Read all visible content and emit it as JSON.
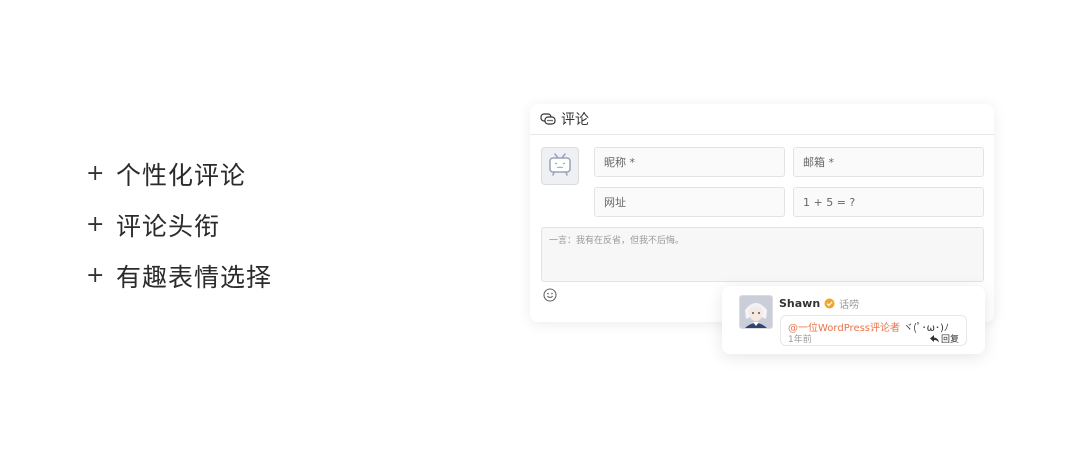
{
  "features": [
    {
      "plus": "+",
      "label": "个性化评论"
    },
    {
      "plus": "+",
      "label": "评论头衔"
    },
    {
      "plus": "+",
      "label": "有趣表情选择"
    }
  ],
  "comment_box": {
    "title": "评论",
    "title_icon": "comment-bubble-icon",
    "avatar_icon": "bilibili-tv-icon",
    "nickname_placeholder": "昵称 *",
    "email_placeholder": "邮箱 *",
    "website_placeholder": "网址",
    "captcha_text": "1 + 5 = ?",
    "textarea_placeholder": "一言：我有在反省，但我不后悔。",
    "emoji_icon": "smiley-icon"
  },
  "comment_preview": {
    "author": "Shawn",
    "badge_icon": "verified-badge-icon",
    "badge_color": "#f0a52b",
    "title_tag": "话唠",
    "mention": "@一位WordPress评论者",
    "kaomoji": "ヾ(ﾟ･ω･)ﾉ",
    "time": "1年前",
    "reply_label": "回复",
    "mention_color": "#e9734c"
  }
}
